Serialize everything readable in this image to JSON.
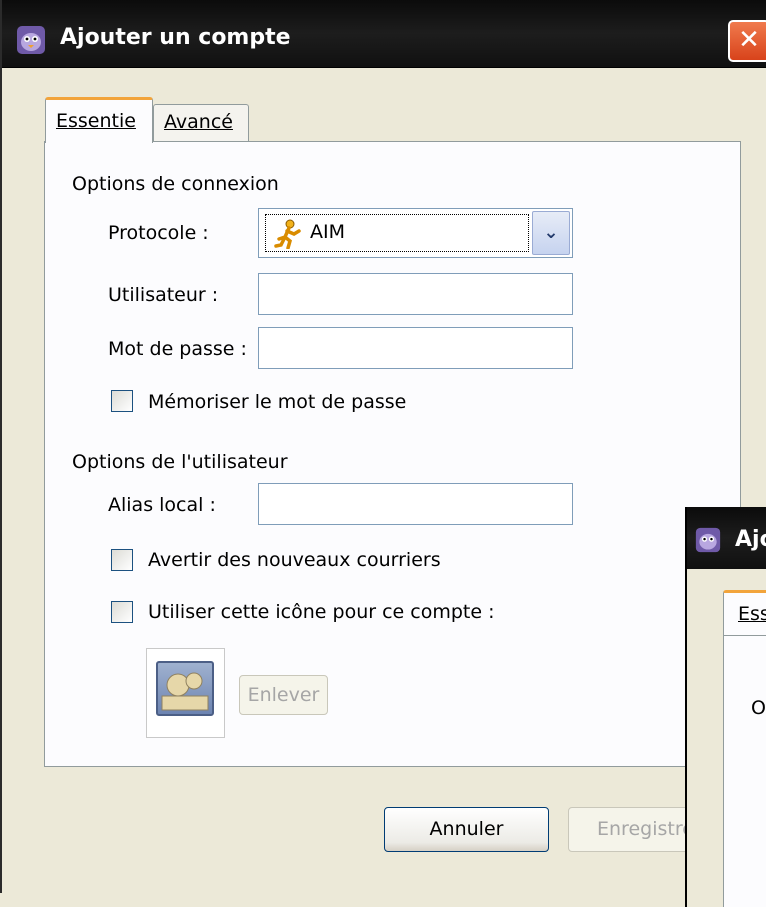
{
  "window": {
    "title": "Ajouter un compte",
    "close_glyph": "✕",
    "icon": "pidgin-icon"
  },
  "tabs": [
    {
      "label": "Essentie",
      "active": true
    },
    {
      "label": "Avancé",
      "active": false
    }
  ],
  "connection": {
    "section_label": "Options de connexion",
    "protocol_label": "Protocole :",
    "protocol_value": "AIM",
    "protocol_icon": "aim-running-man-icon",
    "username_label": "Utilisateur :",
    "username_value": "",
    "password_label": "Mot de passe :",
    "password_value": "",
    "remember_label": "Mémoriser le mot de passe",
    "remember_checked": false
  },
  "user_options": {
    "section_label": "Options de l'utilisateur",
    "alias_label": "Alias local :",
    "alias_value": "",
    "new_mail_label": "Avertir des nouveaux courriers",
    "new_mail_checked": false,
    "use_icon_label": "Utiliser cette icône pour ce compte :",
    "use_icon_checked": false,
    "remove_label": "Enlever"
  },
  "buttons": {
    "cancel": "Annuler",
    "save": "Enregistre"
  },
  "second_window": {
    "title": "Ajo",
    "tab_label": "Ess",
    "section_initial": "O"
  },
  "colors": {
    "titlebar": "#111111",
    "tab_accent": "#f2a43b",
    "close_button": "#e0522a"
  }
}
